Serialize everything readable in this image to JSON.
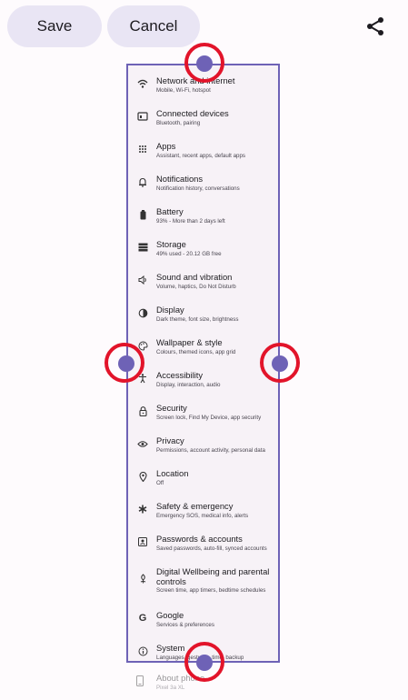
{
  "toolbar": {
    "save_label": "Save",
    "cancel_label": "Cancel",
    "share_icon": "share-icon"
  },
  "settings": [
    {
      "title": "Network and internet",
      "subtitle": "Mobile, Wi-Fi, hotspot",
      "icon": "wifi-icon"
    },
    {
      "title": "Connected devices",
      "subtitle": "Bluetooth, pairing",
      "icon": "devices-icon"
    },
    {
      "title": "Apps",
      "subtitle": "Assistant, recent apps, default apps",
      "icon": "apps-grid-icon"
    },
    {
      "title": "Notifications",
      "subtitle": "Notification history, conversations",
      "icon": "bell-icon"
    },
    {
      "title": "Battery",
      "subtitle": "93% - More than 2 days left",
      "icon": "battery-icon"
    },
    {
      "title": "Storage",
      "subtitle": "49% used - 20.12 GB free",
      "icon": "storage-icon"
    },
    {
      "title": "Sound and vibration",
      "subtitle": "Volume, haptics, Do Not Disturb",
      "icon": "speaker-icon"
    },
    {
      "title": "Display",
      "subtitle": "Dark theme, font size, brightness",
      "icon": "display-icon"
    },
    {
      "title": "Wallpaper & style",
      "subtitle": "Colours, themed icons, app grid",
      "icon": "palette-icon"
    },
    {
      "title": "Accessibility",
      "subtitle": "Display, interaction, audio",
      "icon": "accessibility-icon"
    },
    {
      "title": "Security",
      "subtitle": "Screen lock, Find My Device, app security",
      "icon": "lock-icon"
    },
    {
      "title": "Privacy",
      "subtitle": "Permissions, account activity, personal data",
      "icon": "privacy-eye-icon"
    },
    {
      "title": "Location",
      "subtitle": "Off",
      "icon": "location-pin-icon"
    },
    {
      "title": "Safety & emergency",
      "subtitle": "Emergency SOS, medical info, alerts",
      "icon": "asterisk-icon"
    },
    {
      "title": "Passwords & accounts",
      "subtitle": "Saved passwords, auto-fill, synced accounts",
      "icon": "account-box-icon"
    },
    {
      "title": "Digital Wellbeing and parental controls",
      "subtitle": "Screen time, app timers, bedtime schedules",
      "icon": "wellbeing-icon"
    },
    {
      "title": "Google",
      "subtitle": "Services & preferences",
      "icon": "google-g-icon"
    },
    {
      "title": "System",
      "subtitle": "Languages, gestures, time, backup",
      "icon": "info-icon"
    }
  ],
  "below_item": {
    "title": "About phone",
    "subtitle": "Pixel 3a XL",
    "icon": "phone-icon"
  },
  "colors": {
    "accent": "#6e62b6",
    "highlight_ring": "#e2142a",
    "button_bg": "#e9e5f4"
  }
}
